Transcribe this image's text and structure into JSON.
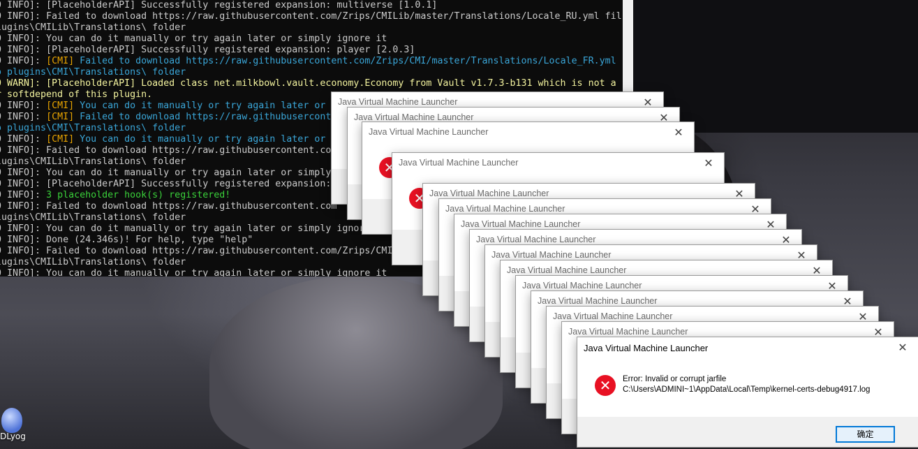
{
  "console": {
    "lines": [
      [
        [
          "gray",
          "0 INFO]: [PlaceholderAPI] Successfully registered expansion: multiverse [1.0.1]"
        ]
      ],
      [
        [
          "gray",
          "0 INFO]: Failed to download https://raw.githubusercontent.com/Zrips/CMILib/master/Translations/Locale_RU.yml fil"
        ]
      ],
      [
        [
          "gray",
          "lugins\\CMILib\\Translations\\ folder"
        ]
      ],
      [
        [
          "gray",
          "0 INFO]: You can do it manually or try again later or simply ignore it"
        ]
      ],
      [
        [
          "gray",
          "0 INFO]: [PlaceholderAPI] Successfully registered expansion: player [2.0.3]"
        ]
      ],
      [
        [
          "gray",
          "0 INFO]: "
        ],
        [
          "gold",
          "[CMI]"
        ],
        [
          "cyan",
          " Failed to download https://raw.githubusercontent.com/Zrips/CMI/master/Translations/Locale_FR.yml"
        ]
      ],
      [
        [
          "cyan",
          "o plugins\\CMI\\Translations\\ folder"
        ]
      ],
      [
        [
          "yellow",
          "0 WARN]: [PlaceholderAPI] Loaded class net.milkbowl.vault.economy.Economy from Vault v1.7.3-b131 which is not a"
        ]
      ],
      [
        [
          "yellow",
          "r softdepend of this plugin."
        ]
      ],
      [
        [
          "gray",
          "0 INFO]: "
        ],
        [
          "gold",
          "[CMI]"
        ],
        [
          "cyan",
          " You can do it manually or try again later or"
        ]
      ],
      [
        [
          "gray",
          "0 INFO]: "
        ],
        [
          "gold",
          "[CMI]"
        ],
        [
          "cyan",
          " Failed to download https://raw.githubusercont"
        ]
      ],
      [
        [
          "cyan",
          "o plugins\\CMI\\Translations\\ folder"
        ]
      ],
      [
        [
          "gray",
          "0 INFO]: "
        ],
        [
          "gold",
          "[CMI]"
        ],
        [
          "cyan",
          " You can do it manually or try again later or"
        ]
      ],
      [
        [
          "gray",
          "0 INFO]: Failed to download https://raw.githubusercontent.com"
        ]
      ],
      [
        [
          "gray",
          "lugins\\CMILib\\Translations\\ folder"
        ]
      ],
      [
        [
          "gray",
          "0 INFO]: You can do it manually or try again later or simply"
        ]
      ],
      [
        [
          "gray",
          "0 INFO]: [PlaceholderAPI] Successfully registered expansion:"
        ]
      ],
      [
        [
          "gray",
          "0 INFO]: "
        ],
        [
          "green",
          "3 placeholder hook(s) registered!"
        ]
      ],
      [
        [
          "gray",
          "0 INFO]: Failed to download https://raw.githubusercontent.com"
        ]
      ],
      [
        [
          "gray",
          "lugins\\CMILib\\Translations\\ folder"
        ]
      ],
      [
        [
          "gray",
          "0 INFO]: You can do it manually or try again later or simply ignor"
        ]
      ],
      [
        [
          "gray",
          "0 INFO]: Done (24.346s)! For help, type \"help\""
        ]
      ],
      [
        [
          "gray",
          "0 INFO]: Failed to download https://raw.githubusercontent.com/Zrips/CMI"
        ]
      ],
      [
        [
          "gray",
          "lugins\\CMILib\\Translations\\ folder"
        ]
      ],
      [
        [
          "gray",
          "0 INFO]: You can do it manually or try again later or simply ignore it"
        ]
      ]
    ]
  },
  "desktop": {
    "icon_label": "DLyog"
  },
  "dialog": {
    "title": "Java Virtual Machine Launcher",
    "close": "✕",
    "error_icon": "✕",
    "error_line1": "Error: Invalid or corrupt jarfile",
    "error_line2": "C:\\Users\\ADMINI~1\\AppData\\Local\\Temp\\kernel-certs-debug4917.log",
    "ok_label": "确定"
  },
  "colors": {
    "error_red": "#e81123",
    "accent_blue": "#0078d7"
  }
}
